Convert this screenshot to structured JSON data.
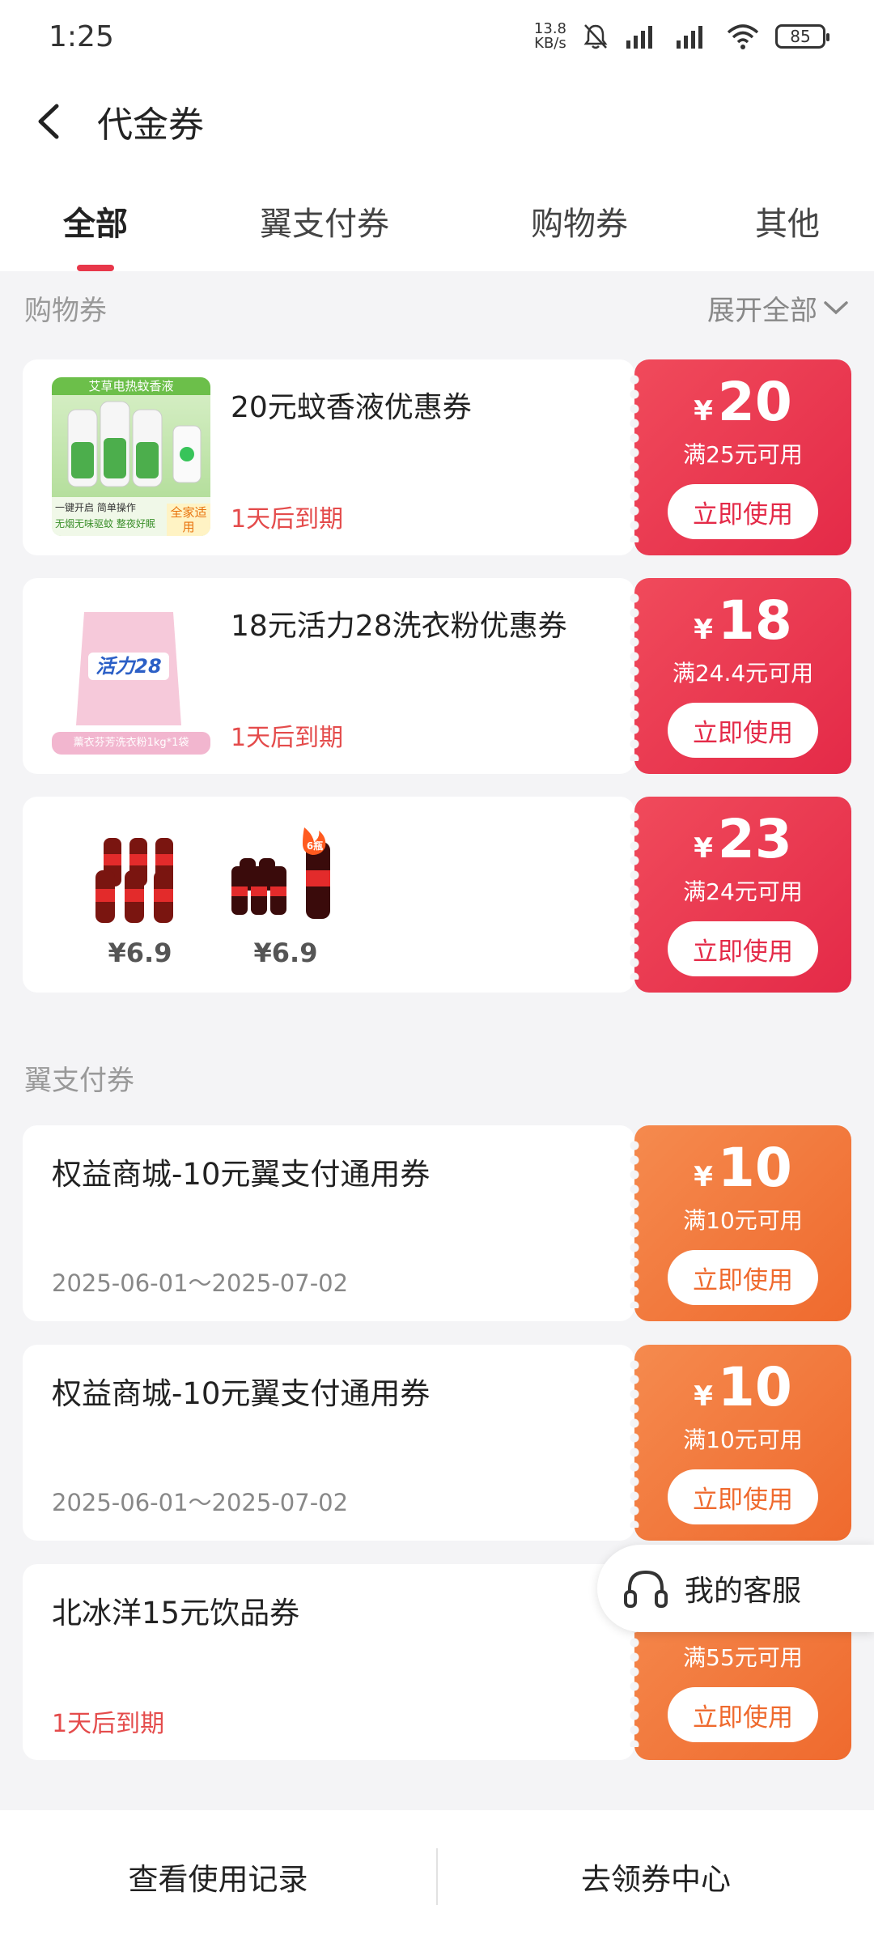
{
  "status_bar": {
    "time": "1:25",
    "net_speed_value": "13.8",
    "net_speed_unit": "KB/s",
    "battery": "85"
  },
  "header": {
    "title": "代金券"
  },
  "tabs": [
    {
      "label": "全部",
      "active": true
    },
    {
      "label": "翼支付券",
      "active": false
    },
    {
      "label": "购物券",
      "active": false
    },
    {
      "label": "其他",
      "active": false
    }
  ],
  "sections": {
    "shopping": {
      "title": "购物券",
      "expand_label": "展开全部"
    },
    "payment": {
      "title": "翼支付券"
    }
  },
  "coupons_shopping": [
    {
      "name": "20元蚊香液优惠券",
      "expiry": "1天后到期",
      "amount": "20",
      "condition": "满25元可用",
      "button": "立即使用",
      "thumb_caption_1": "艾草电热蚊香液",
      "thumb_caption_2": "一键开启 简单操作",
      "thumb_caption_3": "无烟无味驱蚊 整夜好眠",
      "thumb_badge": "全家适用"
    },
    {
      "name": "18元活力28洗衣粉优惠券",
      "expiry": "1天后到期",
      "amount": "18",
      "condition": "满24.4元可用",
      "button": "立即使用",
      "thumb_brand": "活力28",
      "thumb_caption": "薰衣芬芳洗衣粉1kg*1袋"
    },
    {
      "products": [
        {
          "price": "¥6.9"
        },
        {
          "price": "¥6.9"
        }
      ],
      "product_badge": "6瓶",
      "amount": "23",
      "condition": "满24元可用",
      "button": "立即使用"
    }
  ],
  "coupons_payment": [
    {
      "name": "权益商城-10元翼支付通用券",
      "date_range": "2025-06-01～2025-07-02",
      "amount": "10",
      "condition": "满10元可用",
      "button": "立即使用"
    },
    {
      "name": "权益商城-10元翼支付通用券",
      "date_range": "2025-06-01～2025-07-02",
      "amount": "10",
      "condition": "满10元可用",
      "button": "立即使用"
    },
    {
      "name": "北冰洋15元饮品券",
      "expiry": "1天后到期",
      "condition": "满55元可用",
      "button": "立即使用"
    }
  ],
  "currency_symbol": "¥",
  "customer_service": {
    "label": "我的客服"
  },
  "bottom_bar": {
    "history": "查看使用记录",
    "center": "去领券中心"
  },
  "colors": {
    "accent_red": "#e42a48",
    "accent_orange": "#ef6a2e",
    "expiry_red": "#e44b4b"
  }
}
